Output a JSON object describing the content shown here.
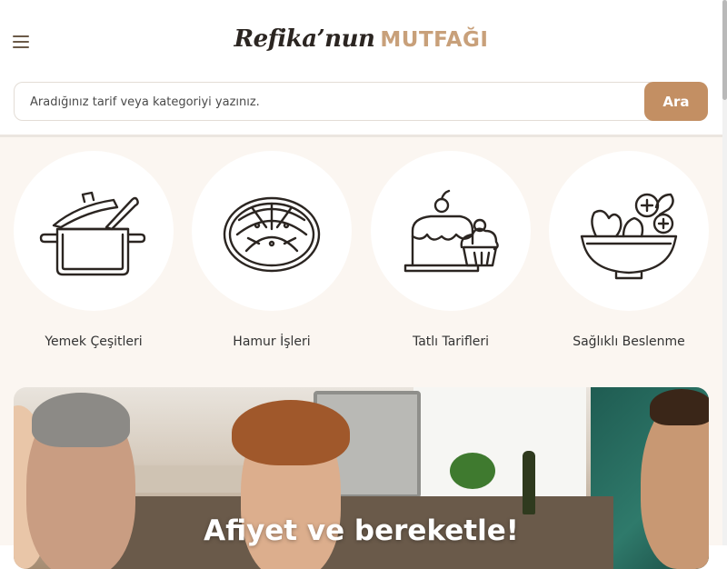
{
  "header": {
    "brand_script": "Refika’nun",
    "brand_caps": "MUTFAĞI",
    "menu_icon": "hamburger-icon"
  },
  "search": {
    "placeholder": "Aradığınız tarif veya kategoriyi yazınız.",
    "value": "",
    "button_label": "Ara"
  },
  "categories": [
    {
      "label": "Yemek Çeşitleri",
      "icon": "pot-icon"
    },
    {
      "label": "Hamur İşleri",
      "icon": "bread-icon"
    },
    {
      "label": "Tatlı Tarifleri",
      "icon": "cake-icon"
    },
    {
      "label": "Sağlıklı Beslenme",
      "icon": "salad-bowl-icon"
    }
  ],
  "hero": {
    "title": "Afiyet ve bereketle!"
  },
  "colors": {
    "accent": "#c38f63",
    "logo_caps": "#c8a07a",
    "section_bg": "#fbf6f1"
  }
}
